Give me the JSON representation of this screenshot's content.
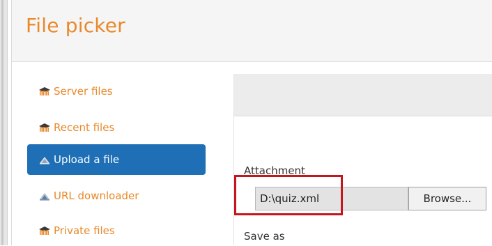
{
  "dialog": {
    "title": "File picker"
  },
  "sidebar": {
    "items": [
      {
        "label": "Server files",
        "icon": "moodle-icon",
        "active": false
      },
      {
        "label": "Recent files",
        "icon": "moodle-icon",
        "active": false
      },
      {
        "label": "Upload a file",
        "icon": "upload-icon",
        "active": true
      },
      {
        "label": "URL downloader",
        "icon": "url-downloader-icon",
        "active": false
      },
      {
        "label": "Private files",
        "icon": "moodle-icon",
        "active": false
      }
    ]
  },
  "upload_form": {
    "attachment_label": "Attachment",
    "file_path_value": "D:\\quiz.xml",
    "browse_label": "Browse...",
    "save_as_label": "Save as"
  },
  "colors": {
    "accent_orange": "#e8892b",
    "active_blue": "#1e6fb6",
    "highlight_red": "#c4161c"
  }
}
